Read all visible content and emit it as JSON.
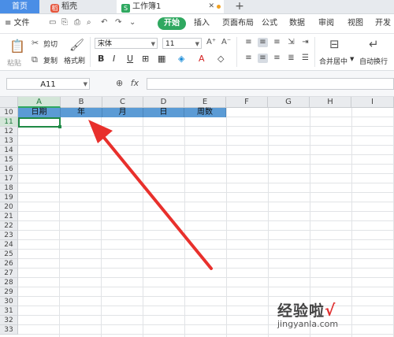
{
  "tabs": {
    "home": "首页",
    "daoke": "稻壳",
    "workbook": "工作簿1",
    "add": "+"
  },
  "menubar": {
    "file": "≡ 文件",
    "items": [
      "开始",
      "插入",
      "页面布局",
      "公式",
      "数据",
      "审阅",
      "视图",
      "开发"
    ]
  },
  "ribbon": {
    "cut": "剪切",
    "copy": "复制",
    "paste": "粘贴",
    "format_painter": "格式刷",
    "font": "宋体",
    "size": "11",
    "bold": "B",
    "italic": "I",
    "underline": "U",
    "merge_center": "合并居中",
    "wrap": "自动换行"
  },
  "formula": {
    "name_box": "A11",
    "fx": "fx",
    "value": ""
  },
  "sheet": {
    "columns": [
      "A",
      "B",
      "C",
      "D",
      "E",
      "F",
      "G",
      "H",
      "I"
    ],
    "rows": [
      "10",
      "11",
      "12",
      "13",
      "14",
      "15",
      "16",
      "17",
      "18",
      "19",
      "20",
      "21",
      "22",
      "23",
      "24",
      "25",
      "26",
      "27",
      "28",
      "29",
      "30",
      "31",
      "32",
      "33"
    ],
    "header_cells": [
      "日期",
      "年",
      "月",
      "日",
      "周数"
    ],
    "header_fill": "#5b9bd5",
    "selected_cell": "A11"
  },
  "annotation": {
    "arrow_color": "#e8302c"
  },
  "watermark": {
    "chinese": "经验啦",
    "check": "√",
    "url": "jingyanla.com"
  }
}
